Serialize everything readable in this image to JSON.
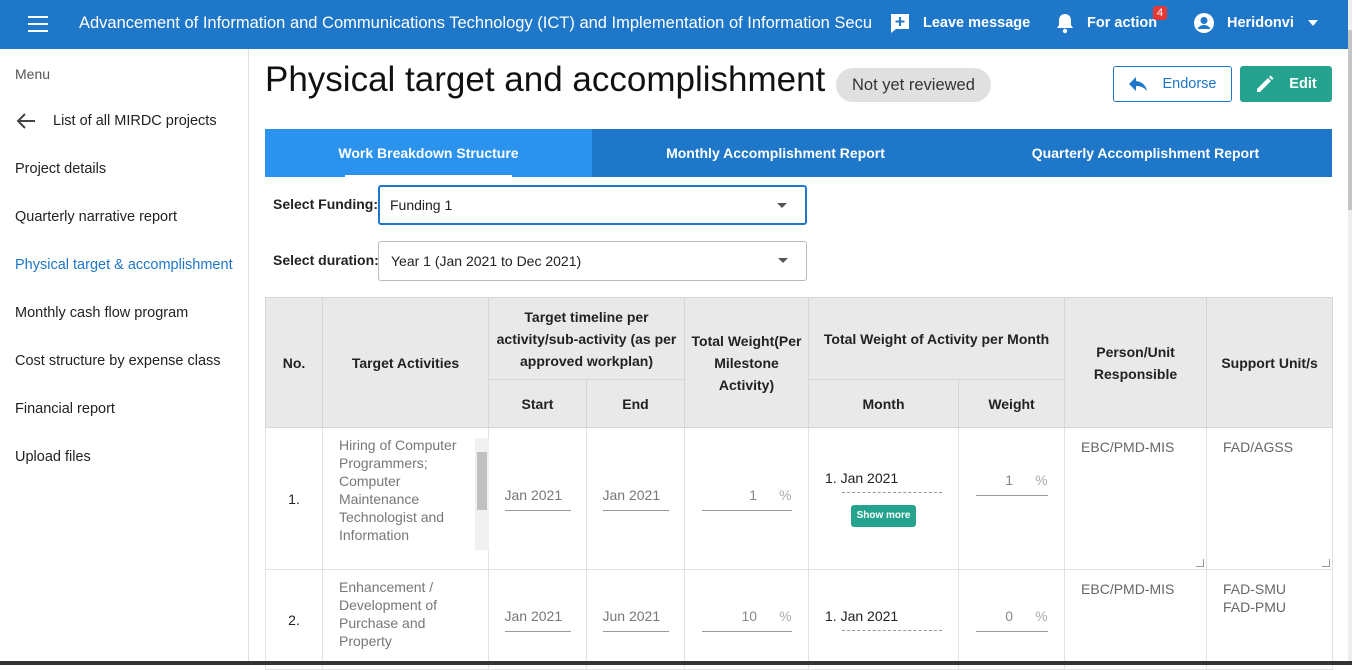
{
  "topbar": {
    "title": "Advancement of Information and Communications Technology (ICT) and Implementation of Information Security",
    "leave_message": "Leave message",
    "for_action": "For action",
    "for_action_count": "4",
    "user": "Heridonvi"
  },
  "sidebar": {
    "menu_label": "Menu",
    "back_label": "List of all MIRDC projects",
    "items": [
      {
        "label": "Project details"
      },
      {
        "label": "Quarterly narrative report"
      },
      {
        "label": "Physical target & accomplishment"
      },
      {
        "label": "Monthly cash flow program"
      },
      {
        "label": "Cost structure by expense class"
      },
      {
        "label": "Financial report"
      },
      {
        "label": "Upload files"
      }
    ]
  },
  "main": {
    "title": "Physical target and accomplishment",
    "status": "Not yet reviewed",
    "endorse_label": "Endorse",
    "edit_label": "Edit",
    "tabs": [
      {
        "label": "Work Breakdown Structure"
      },
      {
        "label": "Monthly Accomplishment Report"
      },
      {
        "label": "Quarterly Accomplishment Report"
      }
    ],
    "funding_label": "Select Funding:",
    "funding_value": "Funding 1",
    "duration_label": "Select duration:",
    "duration_value": "Year 1 (Jan 2021 to Dec 2021)"
  },
  "table": {
    "headers": {
      "no": "No.",
      "activities": "Target Activities",
      "timeline": "Target timeline per activity/sub-activity (as per approved workplan)",
      "start": "Start",
      "end": "End",
      "total_weight": "Total Weight(Per Milestone Activity)",
      "weight_per_month": "Total Weight of Activity per Month",
      "month": "Month",
      "weight": "Weight",
      "person": "Person/Unit Responsible",
      "support": "Support Unit/s"
    },
    "rows": [
      {
        "no": "1.",
        "activity": "Hiring of Computer Programmers; Computer Maintenance Technologist and Information",
        "start": "Jan 2021",
        "end": "Jan 2021",
        "total_weight": "1",
        "month": "1. Jan 2021",
        "month_weight": "1",
        "show_more": "Show more",
        "person": "EBC/PMD-MIS",
        "support": "FAD/AGSS"
      },
      {
        "no": "2.",
        "activity": "Enhancement / Development of Purchase and Property",
        "start": "Jan 2021",
        "end": "Jun 2021",
        "total_weight": "10",
        "month": "1. Jan 2021",
        "month_weight": "0",
        "person": "EBC/PMD-MIS",
        "support": "FAD-SMU\nFAD-PMU"
      }
    ],
    "pct_symbol": "%"
  }
}
